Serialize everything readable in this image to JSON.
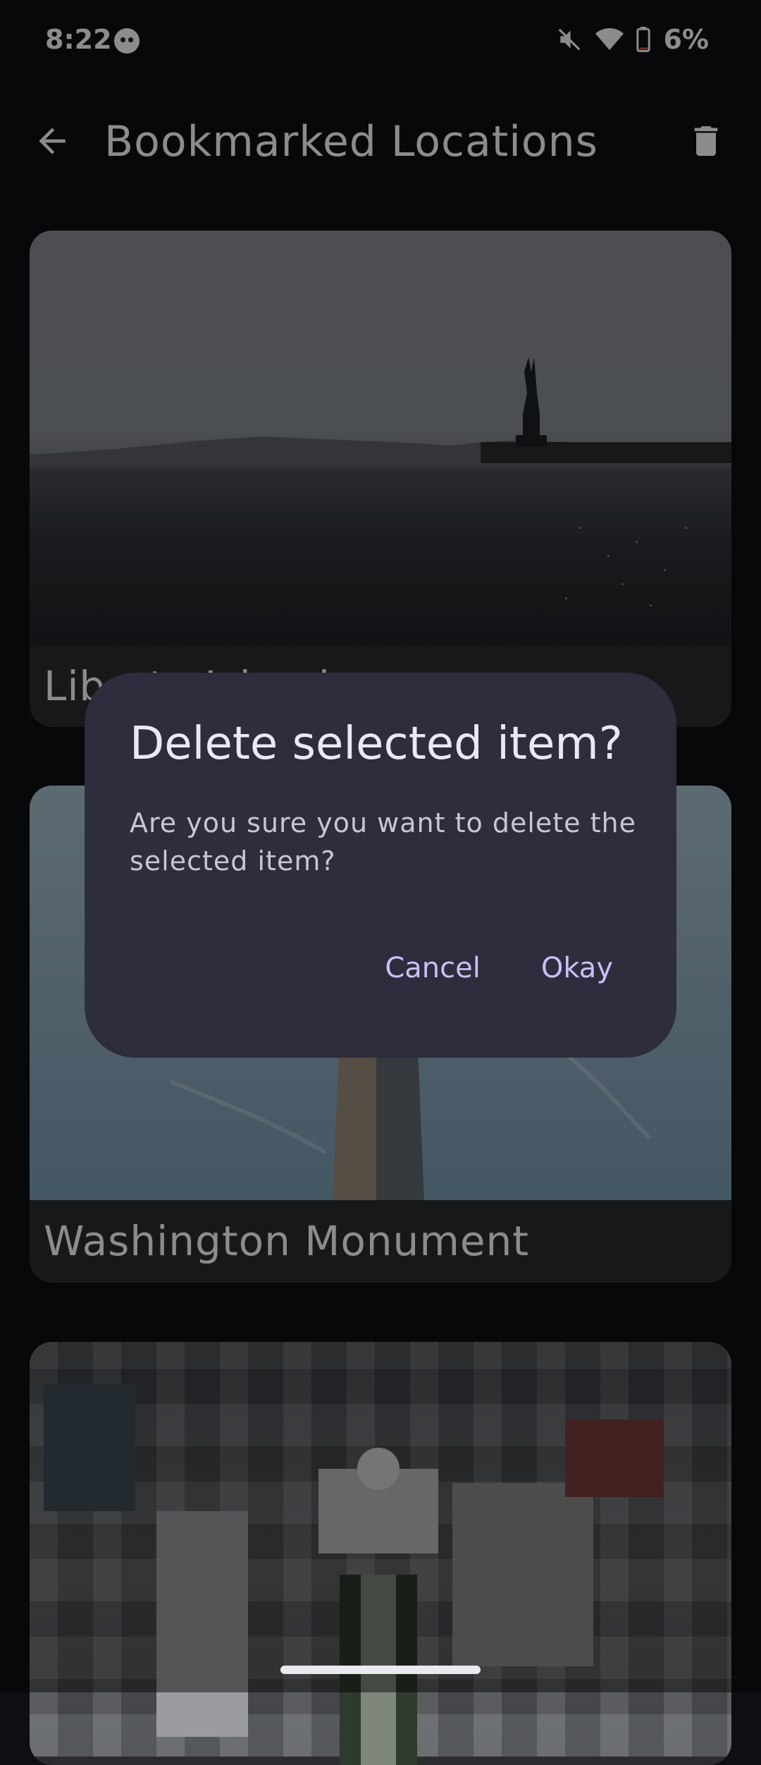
{
  "status_bar": {
    "time": "8:22",
    "battery": "6%"
  },
  "app_bar": {
    "title": "Bookmarked Locations"
  },
  "cards": [
    {
      "label": "Liberty Island"
    },
    {
      "label": "Washington Monument"
    },
    {
      "label": ""
    }
  ],
  "dialog": {
    "title": "Delete selected item?",
    "message": "Are you sure you want to delete the selected item?",
    "cancel_label": "Cancel",
    "confirm_label": "Okay"
  },
  "colors": {
    "dialog_bg": "#2e2d3d",
    "accent": "#c5c1f5",
    "background": "#0e0f13"
  }
}
